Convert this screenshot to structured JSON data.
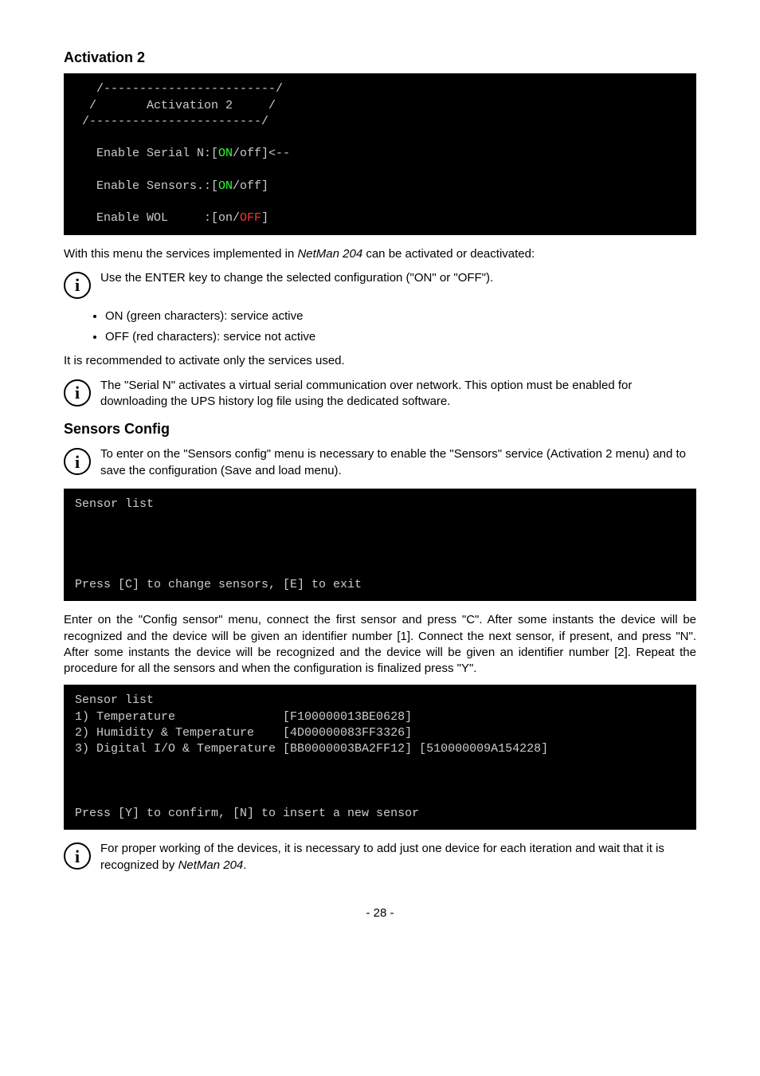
{
  "headings": {
    "activation2": "Activation 2",
    "sensorsConfig": "Sensors Config"
  },
  "terminal1": {
    "line1": "   /------------------------/",
    "line2": "  /       Activation 2     /",
    "line3": " /------------------------/",
    "enableSerial_pre": "   Enable Serial N:[",
    "on1": "ON",
    "enableSerial_post": "/off]<--",
    "enableSensors_pre": "   Enable Sensors.:[",
    "on2": "ON",
    "enableSensors_post": "/off]",
    "enableWol_pre": "   Enable WOL     :[on/",
    "off1": "OFF",
    "enableWol_post": "]"
  },
  "paras": {
    "p1_pre": "With this menu the services implemented in ",
    "p1_em": "NetMan 204",
    "p1_post": " can be activated or deactivated:",
    "info1": "Use the ENTER key to change the selected configuration (\"ON\" or \"OFF\").",
    "bullet1": "ON (green characters): service active",
    "bullet2": "OFF (red characters): service not active",
    "p2": "It is recommended to activate only the services used.",
    "info2": "The \"Serial N\" activates a virtual serial communication over network. This option must be enabled for downloading the UPS history log file using the dedicated software.",
    "info3": "To enter on the \"Sensors config\" menu is necessary to enable the \"Sensors\" service (Activation 2 menu) and to save the configuration (Save and load menu).",
    "p3": "Enter on the \"Config sensor\" menu, connect the first sensor and press \"C\". After some instants the device will be recognized and the device will be given an identifier number [1]. Connect the next sensor, if present, and press \"N\". After some instants the device will be recognized and the device will be given an identifier number [2]. Repeat the procedure for all the sensors and when the configuration is finalized press \"Y\".",
    "info4_pre": "For proper working of the devices, it is necessary to add just one device for each iteration and wait that it is recognized by ",
    "info4_em": "NetMan 204",
    "info4_post": "."
  },
  "terminal2": {
    "line1": "Sensor list",
    "blank": "",
    "line_last": "Press [C] to change sensors, [E] to exit"
  },
  "terminal3": {
    "line1": "Sensor list",
    "line2": "1) Temperature               [F100000013BE0628]",
    "line3": "2) Humidity & Temperature    [4D00000083FF3326]",
    "line4": "3) Digital I/O & Temperature [BB0000003BA2FF12] [510000009A154228]",
    "blank": "",
    "line_last": "Press [Y] to confirm, [N] to insert a new sensor"
  },
  "pageNumber": "- 28 -"
}
